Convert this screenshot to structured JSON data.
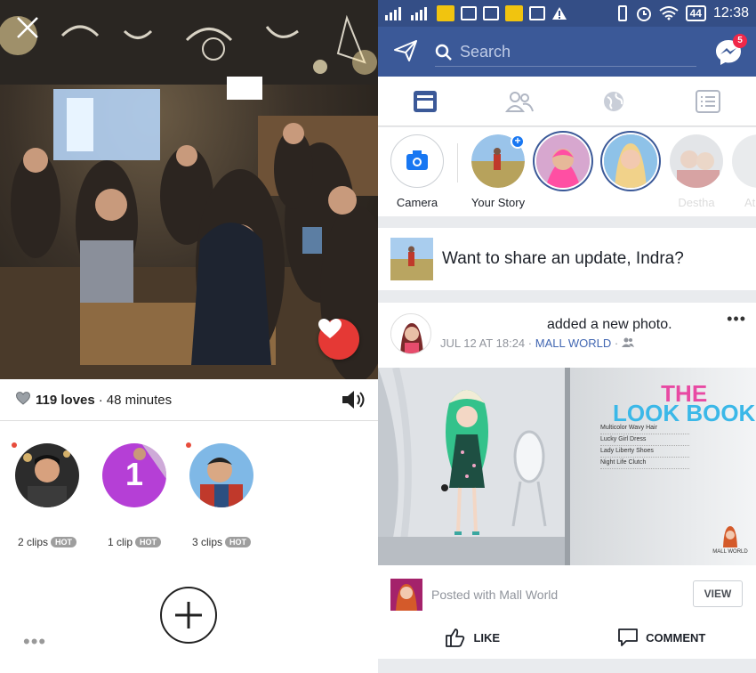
{
  "left_panel": {
    "loves_count": "119 loves",
    "separator": "·",
    "duration": "48 minutes",
    "clips": [
      {
        "count": "2 clips",
        "badge": "HOT"
      },
      {
        "count": "1 clip",
        "badge": "HOT",
        "number": "1"
      },
      {
        "count": "3 clips",
        "badge": "HOT"
      }
    ],
    "more": "•••"
  },
  "status_bar": {
    "battery": "44",
    "time": "12:38"
  },
  "header": {
    "search_placeholder": "Search",
    "messenger_badge": "5"
  },
  "tabs": [
    "news-feed",
    "friends",
    "notifications",
    "menu"
  ],
  "stories": [
    {
      "label": "Camera"
    },
    {
      "label": "Your Story"
    },
    {
      "label": ""
    },
    {
      "label": ""
    },
    {
      "label": "Destha"
    },
    {
      "label": "At"
    }
  ],
  "composer": {
    "prompt": "Want to share an update, Indra?"
  },
  "post": {
    "action": "added a new photo.",
    "date": "JUL 12 AT 18:24",
    "dot": "·",
    "app": "MALL WORLD",
    "menu": "•••",
    "image": {
      "title_line1": "THE",
      "title_line2": "LOOK BOOK",
      "items": [
        "Multicolor Wavy Hair",
        "Lucky Girl Dress",
        "Lady Liberty Shoes",
        "Night Life Clutch"
      ],
      "logo": "MALL WORLD"
    },
    "posted_with": "Posted with Mall World",
    "view_label": "VIEW",
    "like_label": "LIKE",
    "comment_label": "COMMENT"
  },
  "colors": {
    "facebook_blue": "#3b5998",
    "status_bar": "#344e86",
    "heart_red": "#e53935",
    "clip_purple": "#b53fd6"
  }
}
